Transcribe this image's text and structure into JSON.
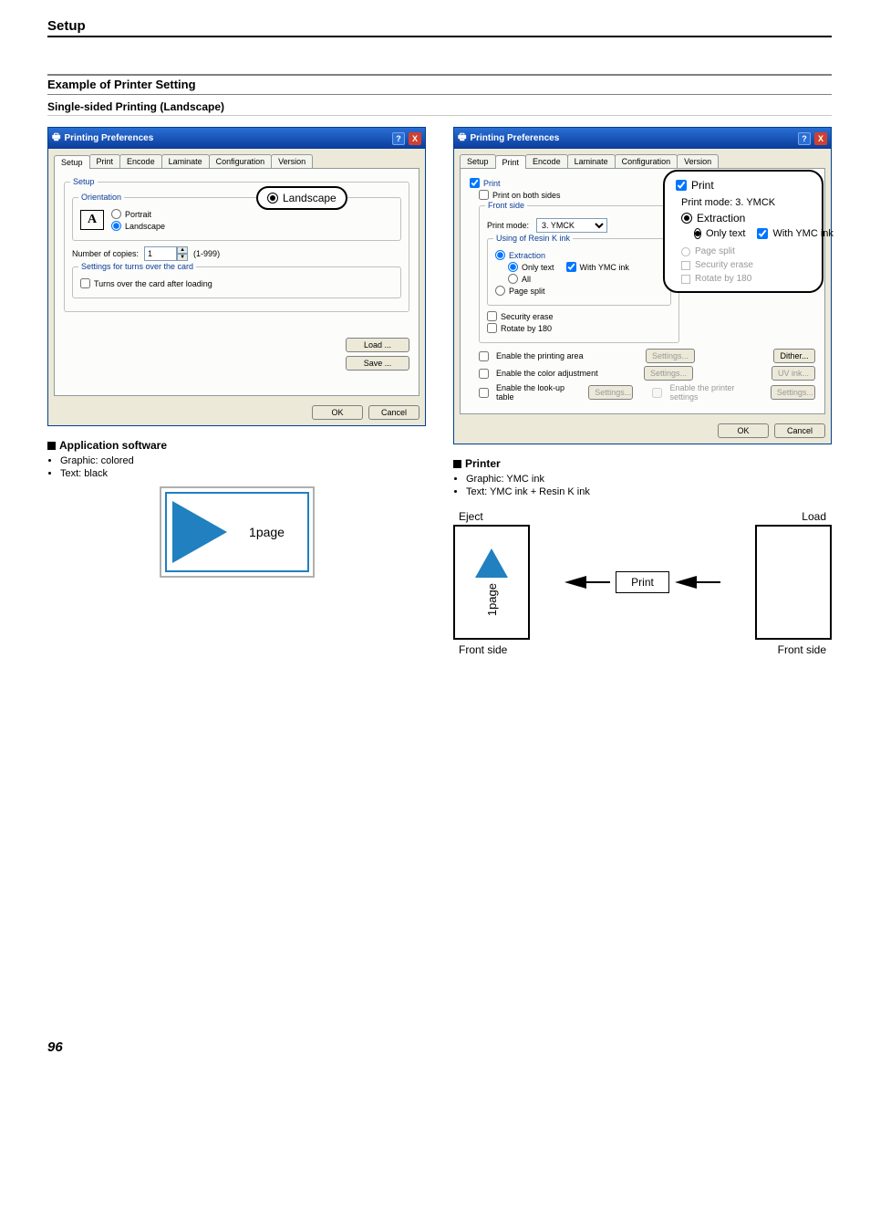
{
  "header": "Setup",
  "section_title": "Example of Printer Setting",
  "subsection_title": "Single-sided Printing (Landscape)",
  "page_number": "96",
  "win": {
    "title": "Printing Preferences",
    "tabs": [
      "Setup",
      "Print",
      "Encode",
      "Laminate",
      "Configuration",
      "Version"
    ],
    "ok": "OK",
    "cancel": "Cancel",
    "load_btn": "Load ...",
    "save_btn": "Save ..."
  },
  "setup_tab": {
    "group": "Setup",
    "orientation": {
      "legend": "Orientation",
      "portrait": "Portrait",
      "landscape": "Landscape",
      "icon_letter": "A"
    },
    "copies": {
      "label": "Number of copies:",
      "value": "1",
      "range": "(1-999)"
    },
    "turns_group": "Settings for turns over the card",
    "turns_check": "Turns over the card after loading"
  },
  "setup_callout": {
    "label": "Landscape"
  },
  "print_tab": {
    "print_check": "Print",
    "both_sides": "Print on both sides",
    "front_side": "Front side",
    "print_mode_label": "Print mode:",
    "print_mode_value": "3. YMCK",
    "resin": {
      "legend": "Using of Resin K ink",
      "extraction": "Extraction",
      "only_text": "Only text",
      "with_ymc": "With YMC ink",
      "all": "All"
    },
    "page_split": "Page split",
    "security_erase": "Security erase",
    "rotate_180": "Rotate by 180",
    "enable_printing_area": "Enable the printing area",
    "enable_color_adj": "Enable the color adjustment",
    "enable_lookup": "Enable the look-up table",
    "enable_printer_settings": "Enable the printer settings",
    "settings_btn": "Settings...",
    "dither_btn": "Dither...",
    "uv_btn": "UV ink..."
  },
  "print_callout": {
    "print": "Print",
    "print_mode_line": "Print mode:  3. YMCK",
    "extraction": "Extraction",
    "only_text": "Only text",
    "with_ymc": "With YMC ink",
    "page_split": "Page split",
    "security_erase": "Security erase",
    "rotate_180": "Rotate by 180"
  },
  "notes_left": {
    "heading": "Application software",
    "items": [
      "Graphic: colored",
      "Text: black"
    ],
    "card_label": "1page"
  },
  "notes_right": {
    "heading": "Printer",
    "items": [
      "Graphic: YMC ink",
      "Text: YMC ink + Resin K ink"
    ]
  },
  "diagram": {
    "eject": "Eject",
    "load": "Load",
    "print": "Print",
    "front_side": "Front side",
    "page_label": "1page"
  }
}
